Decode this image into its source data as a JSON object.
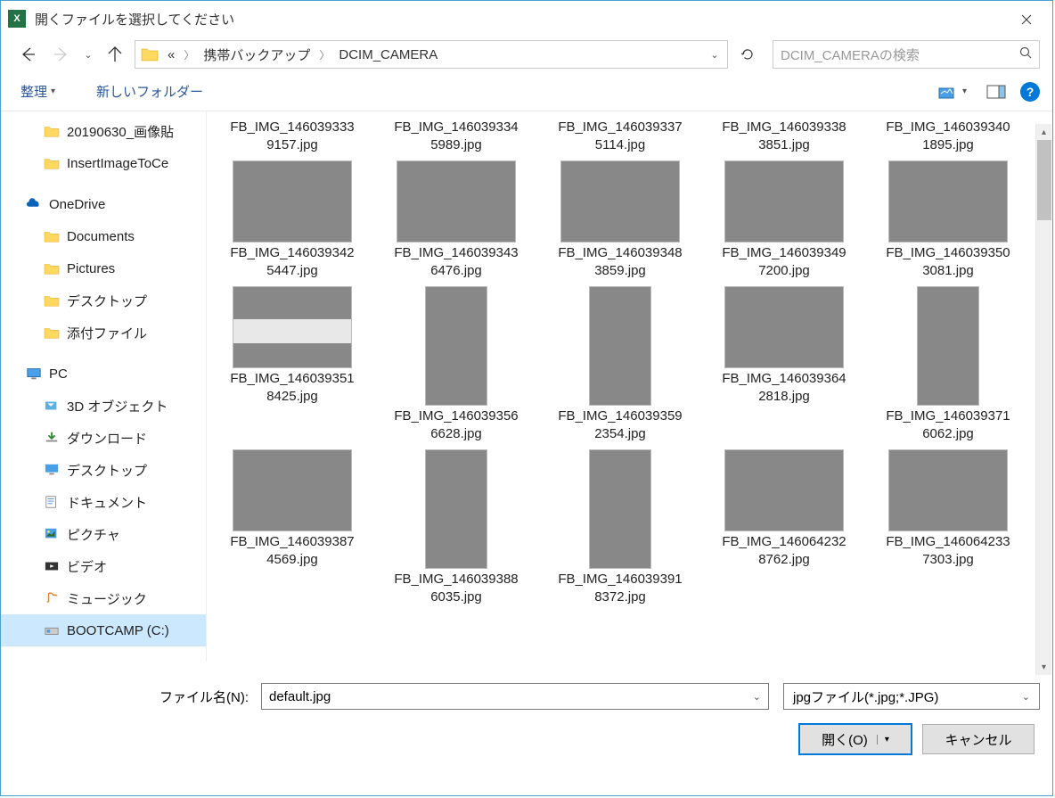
{
  "title": "開くファイルを選択してください",
  "breadcrumb": {
    "overflow": "«",
    "parts": [
      "携帯バックアップ",
      "DCIM_CAMERA"
    ]
  },
  "search": {
    "placeholder": "DCIM_CAMERAの検索"
  },
  "toolbar": {
    "organize": "整理",
    "newfolder": "新しいフォルダー"
  },
  "sidebar": {
    "items": [
      {
        "label": "20190630_画像貼"
      },
      {
        "label": "InsertImageToCe"
      }
    ],
    "onedrive": "OneDrive",
    "onedrive_items": [
      {
        "label": "Documents"
      },
      {
        "label": "Pictures"
      },
      {
        "label": "デスクトップ"
      },
      {
        "label": "添付ファイル"
      }
    ],
    "pc": "PC",
    "pc_items": [
      {
        "label": "3D オブジェクト"
      },
      {
        "label": "ダウンロード"
      },
      {
        "label": "デスクトップ"
      },
      {
        "label": "ドキュメント"
      },
      {
        "label": "ピクチャ"
      },
      {
        "label": "ビデオ"
      },
      {
        "label": "ミュージック"
      },
      {
        "label": "BOOTCAMP (C:)"
      }
    ]
  },
  "files": [
    {
      "name": "FB_IMG_1460393339157.jpg",
      "labelonly": true
    },
    {
      "name": "FB_IMG_1460393345989.jpg",
      "labelonly": true
    },
    {
      "name": "FB_IMG_1460393375114.jpg",
      "labelonly": true
    },
    {
      "name": "FB_IMG_1460393383851.jpg",
      "labelonly": true
    },
    {
      "name": "FB_IMG_1460393401895.jpg",
      "labelonly": true
    },
    {
      "name": "FB_IMG_1460393425447.jpg",
      "cls": "trail"
    },
    {
      "name": "FB_IMG_1460393436476.jpg",
      "cls": "shrine"
    },
    {
      "name": "FB_IMG_1460393483859.jpg",
      "cls": "bird"
    },
    {
      "name": "FB_IMG_1460393497200.jpg",
      "cls": "gulls"
    },
    {
      "name": "FB_IMG_1460393503081.jpg",
      "cls": "city"
    },
    {
      "name": "FB_IMG_1460393518425.jpg",
      "cls": "boat"
    },
    {
      "name": "FB_IMG_1460393566628.jpg",
      "cls": "night",
      "portrait": true
    },
    {
      "name": "FB_IMG_1460393592354.jpg",
      "cls": "sunset",
      "portrait": true
    },
    {
      "name": "FB_IMG_1460393642818.jpg",
      "cls": "market"
    },
    {
      "name": "FB_IMG_1460393716062.jpg",
      "cls": "lantern",
      "portrait": true
    },
    {
      "name": "FB_IMG_1460393874569.jpg",
      "cls": "stained"
    },
    {
      "name": "FB_IMG_1460393886035.jpg",
      "cls": "church",
      "portrait": true
    },
    {
      "name": "FB_IMG_1460393918372.jpg",
      "cls": "hall",
      "portrait": true
    },
    {
      "name": "FB_IMG_1460642328762.jpg",
      "cls": "temple"
    },
    {
      "name": "FB_IMG_1460642337303.jpg",
      "cls": "shrine2"
    }
  ],
  "filename_label": "ファイル名(N):",
  "filename_value": "default.jpg",
  "filter": "jpgファイル(*.jpg;*.JPG)",
  "open": "開く(O)",
  "cancel": "キャンセル"
}
